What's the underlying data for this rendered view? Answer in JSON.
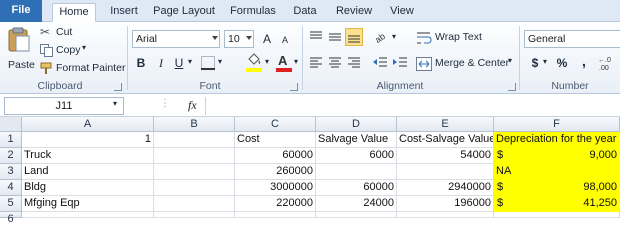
{
  "tabs": [
    "File",
    "Home",
    "Insert",
    "Page Layout",
    "Formulas",
    "Data",
    "Review",
    "View"
  ],
  "clipboard": {
    "paste": "Paste",
    "cut": "Cut",
    "copy": "Copy",
    "format_painter": "Format Painter",
    "label": "Clipboard"
  },
  "font": {
    "name": "Arial",
    "size": "10",
    "grow": "A",
    "shrink": "A",
    "bold": "B",
    "italic": "I",
    "underline": "U",
    "color_letter": "A",
    "label": "Font"
  },
  "alignment": {
    "wrap_text": "Wrap Text",
    "merge_center": "Merge & Center",
    "label": "Alignment"
  },
  "number": {
    "format": "General",
    "currency": "$",
    "percent": "%",
    "comma": ",",
    "label": "Number"
  },
  "formula_bar": {
    "name_box": "J11",
    "fx": "fx",
    "formula": ""
  },
  "columns": [
    "A",
    "B",
    "C",
    "D",
    "E",
    "F"
  ],
  "rows": [
    "1",
    "2",
    "3",
    "4",
    "5",
    "6"
  ],
  "sheet": {
    "r1": {
      "a": "1",
      "b": "",
      "c": "Cost",
      "d": "Salvage Value",
      "e": "Cost-Salvage Value",
      "f": "Depreciation for the year"
    },
    "r2": {
      "a": "Truck",
      "b": "",
      "c": "60000",
      "d": "6000",
      "e": "54000",
      "f_cur": "$",
      "f": "9,000"
    },
    "r3": {
      "a": "Land",
      "b": "",
      "c": "260000",
      "d": "",
      "e": "",
      "f_cur": "",
      "f": "NA"
    },
    "r4": {
      "a": "Bldg",
      "b": "",
      "c": "3000000",
      "d": "60000",
      "e": "2940000",
      "f_cur": "$",
      "f": "98,000"
    },
    "r5": {
      "a": "Mfging Eqp",
      "b": "",
      "c": "220000",
      "d": "24000",
      "e": "196000",
      "f_cur": "$",
      "f": "41,250"
    }
  },
  "colors": {
    "file_tab": "#2f6fb5",
    "highlight": "#ffff00",
    "font_color_bar": "#e02020",
    "fill_color_bar": "#ffff00"
  }
}
